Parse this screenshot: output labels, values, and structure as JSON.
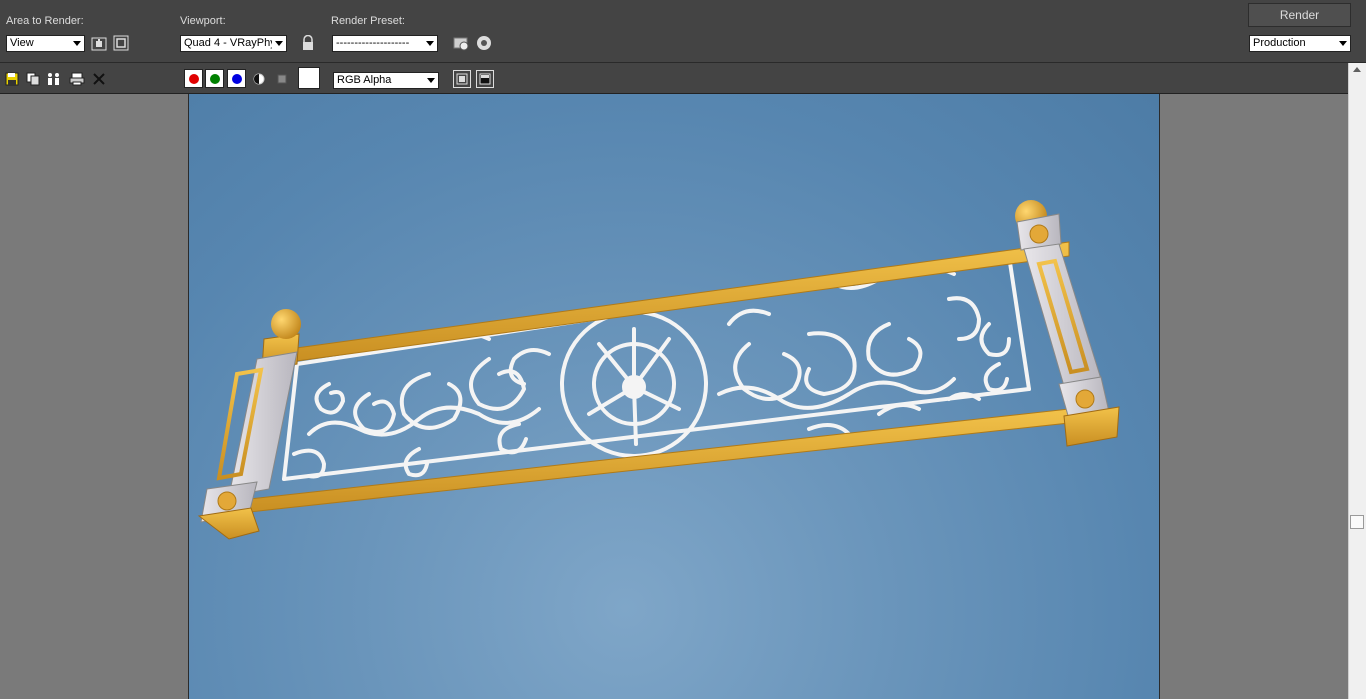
{
  "top": {
    "area_label": "Area to Render:",
    "area_value": "View",
    "viewport_label": "Viewport:",
    "viewport_value": "Quad 4 - VRayPhy",
    "preset_label": "Render Preset:",
    "preset_value": "--------------------",
    "render_button": "Render",
    "render_mode": "Production"
  },
  "second": {
    "channel_display": "RGB Alpha",
    "channels": {
      "red": "#e00000",
      "green": "#008000",
      "blue": "#0000e0"
    }
  },
  "render": {
    "background_color": "#5b89b2",
    "frame_color": "#e0a838",
    "ironwork_color": "#f2f2f2"
  }
}
